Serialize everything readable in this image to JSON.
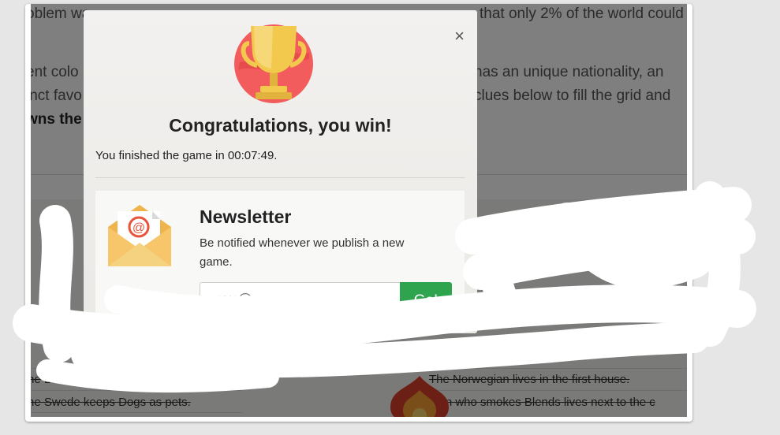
{
  "background": {
    "lines": [
      "oblem wa",
      "that only 2% of the world could",
      "ent colo",
      "has an unique nationality, an",
      "inct favo",
      "clues below to fill the grid and",
      "wns the"
    ],
    "clues": [
      "he Brit lives in the Red h",
      "The Norwegian lives in the first house.",
      "he Swede keeps Dogs as pets.",
      "man who smokes Blends lives next to the c"
    ]
  },
  "modal": {
    "close_label": "×",
    "title": "Congratulations, you win!",
    "finish_text": "You finished the game in 00:07:49.",
    "newsletter": {
      "title": "Newsletter",
      "description": "Be notified whenever we publish a new game.",
      "email_placeholder": "you@example.com",
      "go_label": "Go!"
    }
  },
  "colors": {
    "go_button": "#2ea44f",
    "trophy_gold": "#f2c94c",
    "trophy_circle": "#f25c5c",
    "envelope": "#f7c66b"
  }
}
